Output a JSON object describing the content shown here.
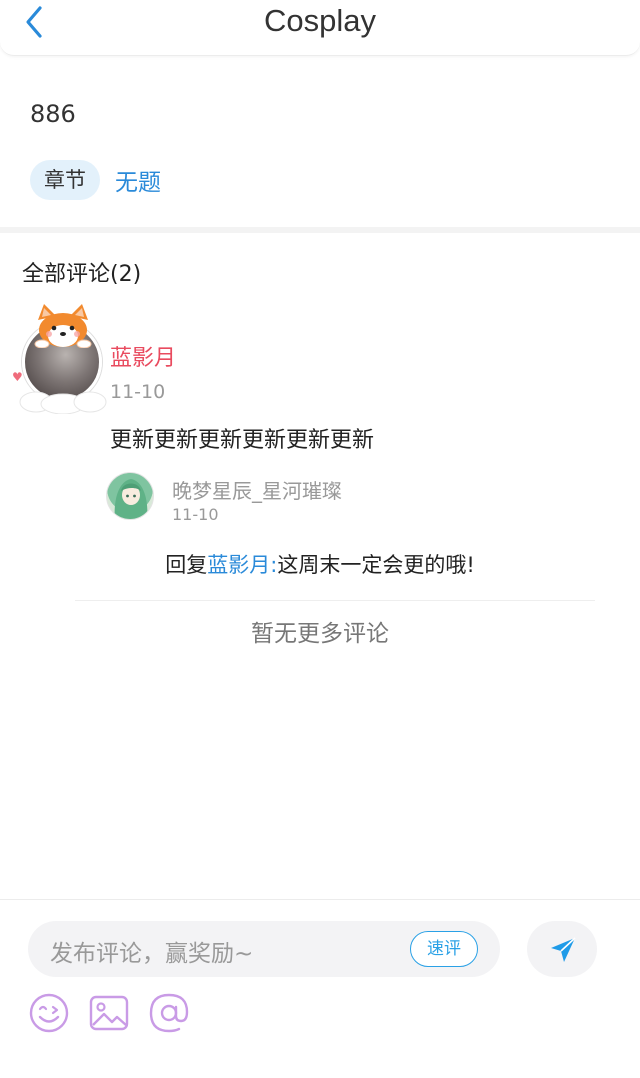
{
  "header": {
    "title": "Cosplay"
  },
  "post": {
    "body": "886",
    "tag_label": "章节",
    "chapter_title": "无题"
  },
  "comments": {
    "title": "全部评论(2)",
    "items": [
      {
        "user": "蓝影月",
        "date": "11-10",
        "text": "更新更新更新更新更新更新",
        "replies": [
          {
            "user": "晚梦星辰_星河璀璨",
            "date": "11-10",
            "prefix": "回复",
            "mention": "蓝影月:",
            "text": "这周末一定会更的哦!"
          }
        ]
      }
    ],
    "no_more": "暂无更多评论"
  },
  "composer": {
    "placeholder": "发布评论，赢奖励~",
    "quick_label": "速评"
  },
  "colors": {
    "accent": "#2a8ad9",
    "username_red": "#e94b5f",
    "tool_icon": "#c99be6",
    "send": "#1f9be8"
  },
  "icons": [
    "back-arrow-icon",
    "corgi-frame-icon",
    "send-icon",
    "emoji-icon",
    "image-icon",
    "at-icon"
  ]
}
